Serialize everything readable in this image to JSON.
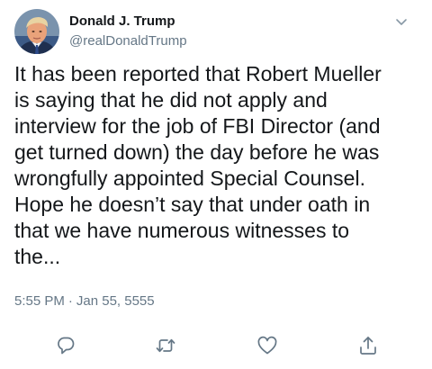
{
  "tweet": {
    "author": {
      "name": "Donald J. Trump",
      "handle": "@realDonaldTrump"
    },
    "text": "It has been reported that Robert Mueller\nis saying that he did not apply and\ninterview for the job of FBI Director (and\nget turned down) the day before he was\nwrongfully appointed Special Counsel.\nHope he doesn’t say that under oath in\nthat we have numerous witnesses to\nthe...",
    "time": "5:55 PM",
    "separator": "·",
    "date": "Jan 55, 5555"
  },
  "icons": {
    "menu": "chevron-down-icon",
    "reply": "reply-icon",
    "retweet": "retweet-icon",
    "like": "heart-icon",
    "share": "share-icon"
  },
  "colors": {
    "text": "#14171a",
    "secondary": "#657786",
    "icon": "#657786"
  }
}
